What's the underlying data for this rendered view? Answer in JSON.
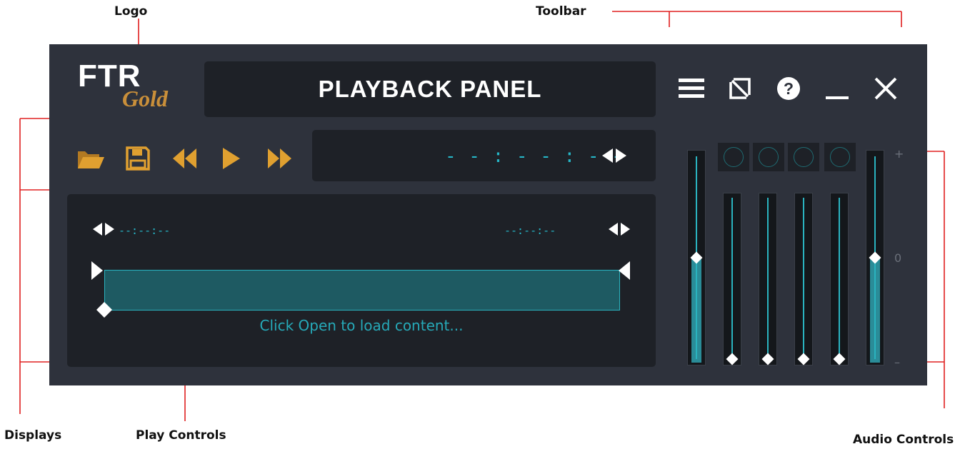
{
  "annotations": {
    "logo": "Logo",
    "toolbar": "Toolbar",
    "displays": "Displays",
    "play_controls": "Play Controls",
    "audio_controls": "Audio Controls"
  },
  "app": {
    "logo_main": "FTR",
    "logo_sub": "Gold",
    "title": "PLAYBACK PANEL"
  },
  "toolbar": {
    "icons": [
      "menu-icon",
      "detach-icon",
      "help-icon",
      "minimize-icon",
      "close-icon"
    ]
  },
  "play_controls": {
    "icons": [
      "folder-open-icon",
      "save-icon",
      "rewind-icon",
      "play-icon",
      "fast-forward-icon"
    ],
    "icon_color": "#e0a030"
  },
  "time_display": {
    "value": "- - : - - : - -"
  },
  "display": {
    "start_time": "--:--:--",
    "end_time": "--:--:--",
    "hint": "Click Open to load content..."
  },
  "audio": {
    "master_left_level": 0.5,
    "master_right_level": 0.5,
    "channel_levels": [
      0,
      0,
      0,
      0
    ],
    "scale_plus": "+",
    "scale_zero": "0",
    "scale_minus": "–"
  },
  "colors": {
    "panel": "#2e323c",
    "box": "#1e2127",
    "accent": "#26b7c8",
    "annotation": "#e02020"
  }
}
